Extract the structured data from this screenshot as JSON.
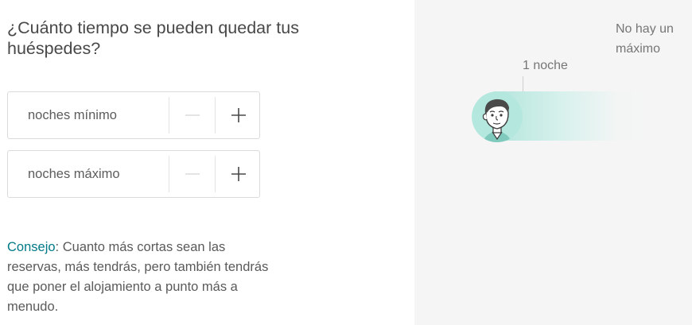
{
  "question": "¿Cuánto tiempo se pueden quedar tus huéspedes?",
  "min_nights": {
    "placeholder": "noches mínimo",
    "value": ""
  },
  "max_nights": {
    "placeholder": "noches máximo",
    "value": ""
  },
  "tip": {
    "label": "Consejo",
    "separator": ":",
    "text": " Cuanto más cortas sean las reservas, más tendrás, pero también tendrás que poner el alojamiento a punto más a menudo."
  },
  "illustration": {
    "min_label": "1 noche",
    "max_label": "No hay un máximo",
    "track_color": "#a7e2d8",
    "avatar_bg": "#b4e8df",
    "accent": "#007a87",
    "icons": {
      "decrement": "minus-icon",
      "increment": "plus-icon",
      "avatar": "guest-face-icon"
    }
  }
}
